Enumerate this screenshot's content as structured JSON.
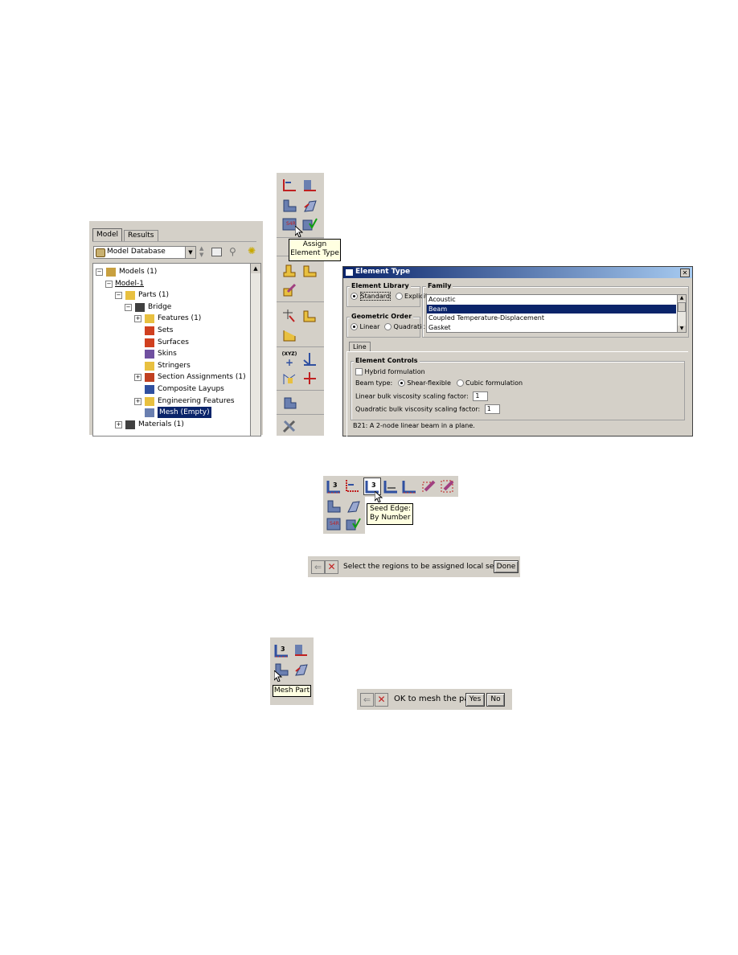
{
  "tree_panel": {
    "tabs": [
      "Model",
      "Results"
    ],
    "database_select": "Model Database",
    "items": [
      {
        "label": "Models (1)",
        "indent": 0,
        "toggle": "−"
      },
      {
        "label": "Model-1",
        "indent": 1,
        "toggle": "−"
      },
      {
        "label": "Parts (1)",
        "indent": 2,
        "toggle": "−"
      },
      {
        "label": "Bridge",
        "indent": 3,
        "toggle": "−"
      },
      {
        "label": "Features (1)",
        "indent": 4,
        "toggle": "+"
      },
      {
        "label": "Sets",
        "indent": 4,
        "toggle": ""
      },
      {
        "label": "Surfaces",
        "indent": 4,
        "toggle": ""
      },
      {
        "label": "Skins",
        "indent": 4,
        "toggle": ""
      },
      {
        "label": "Stringers",
        "indent": 4,
        "toggle": ""
      },
      {
        "label": "Section Assignments (1)",
        "indent": 4,
        "toggle": "+"
      },
      {
        "label": "Composite Layups",
        "indent": 4,
        "toggle": ""
      },
      {
        "label": "Engineering Features",
        "indent": 4,
        "toggle": "+"
      },
      {
        "label": "Mesh (Empty)",
        "indent": 4,
        "toggle": ""
      },
      {
        "label": "Materials (1)",
        "indent": 2,
        "toggle": "+"
      }
    ]
  },
  "toolbox_tooltip": {
    "line1": "Assign",
    "line2": "Element Type"
  },
  "element_type_dialog": {
    "title": "Element Type",
    "library_label": "Element Library",
    "library_options": [
      "Standard",
      "Explicit"
    ],
    "family_label": "Family",
    "family_items": [
      "Acoustic",
      "Beam",
      "Coupled Temperature-Displacement",
      "Gasket"
    ],
    "family_selected": "Beam",
    "order_label": "Geometric Order",
    "order_options": [
      "Linear",
      "Quadratic"
    ],
    "tab_label": "Line",
    "controls_label": "Element Controls",
    "hybrid_label": "Hybrid formulation",
    "beam_type_label": "Beam type:",
    "beam_type_options": [
      "Shear-flexible",
      "Cubic formulation"
    ],
    "linear_bulk_label": "Linear bulk viscosity scaling factor:",
    "linear_bulk_value": "1",
    "quad_bulk_label": "Quadratic bulk viscosity scaling factor:",
    "quad_bulk_value": "1",
    "description": "B21:  A 2-node linear beam in a plane."
  },
  "seed_tooltip": {
    "line1": "Seed Edge:",
    "line2": "By Number"
  },
  "seed_prompt": {
    "text": "Select the regions to be assigned local seeds",
    "done_label": "Done"
  },
  "mesh_tooltip": {
    "text": "Mesh Part"
  },
  "mesh_prompt": {
    "text": "OK to mesh the part?",
    "yes_label": "Yes",
    "no_label": "No"
  },
  "colors": {
    "selection": "#0a246a",
    "face": "#d4d0c8",
    "title_gradient_start": "#0a246a",
    "title_gradient_end": "#a6caf0"
  }
}
